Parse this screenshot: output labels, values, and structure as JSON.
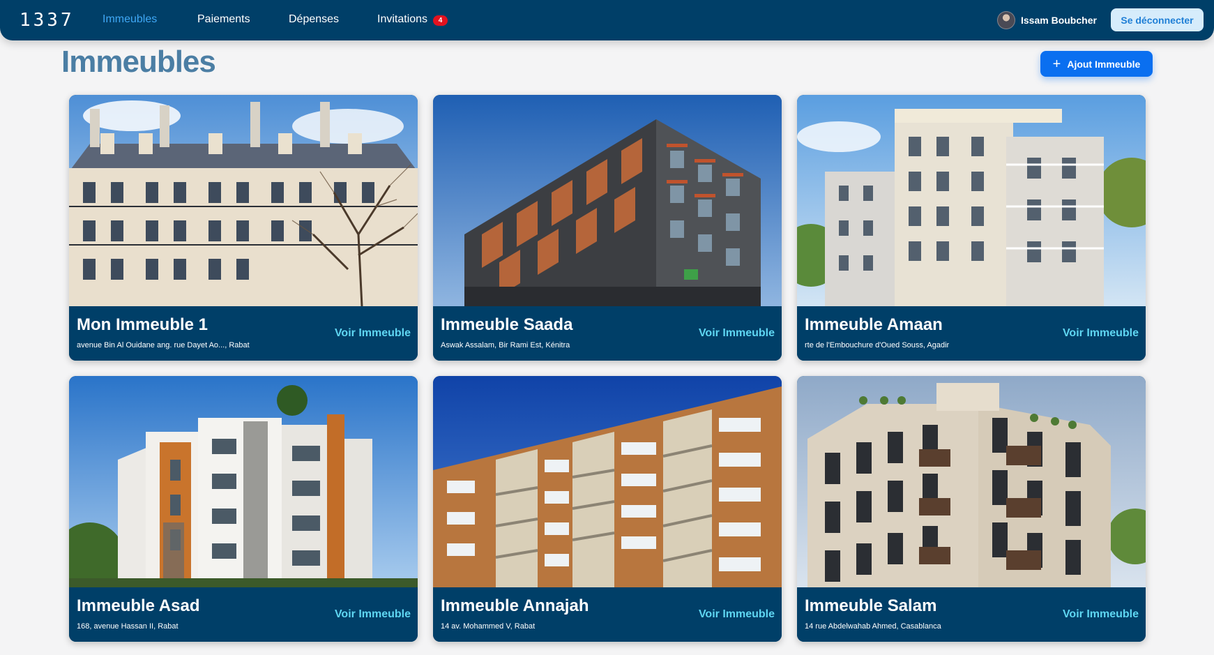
{
  "brand": {
    "logo_text": "1337"
  },
  "nav": {
    "items": [
      {
        "label": "Immeubles",
        "active": true
      },
      {
        "label": "Paiements",
        "active": false
      },
      {
        "label": "Dépenses",
        "active": false
      },
      {
        "label": "Invitations",
        "active": false
      }
    ],
    "invitations_badge": "4"
  },
  "user": {
    "name": "Issam Boubcher",
    "logout_label": "Se déconnecter"
  },
  "page": {
    "title": "Immeubles",
    "add_button_label": "Ajout Immeuble"
  },
  "buildings": [
    {
      "name": "Mon Immeuble 1",
      "address": "avenue Bin Al Ouidane ang. rue Dayet Ao..., Rabat",
      "link_label": "Voir Immeuble"
    },
    {
      "name": "Immeuble Saada",
      "address": "Aswak Assalam, Bir Rami Est, Kénitra",
      "link_label": "Voir Immeuble"
    },
    {
      "name": "Immeuble Amaan",
      "address": "rte de l'Embouchure d'Oued Souss, Agadir",
      "link_label": "Voir Immeuble"
    },
    {
      "name": "Immeuble Asad",
      "address": "168, avenue Hassan II, Rabat",
      "link_label": "Voir Immeuble"
    },
    {
      "name": "Immeuble Annajah",
      "address": "14 av. Mohammed V, Rabat",
      "link_label": "Voir Immeuble"
    },
    {
      "name": "Immeuble Salam",
      "address": "14 rue Abdelwahab Ahmed, Casablanca",
      "link_label": "Voir Immeuble"
    }
  ],
  "colors": {
    "navbar": "#003f68",
    "active_nav": "#3fa8f5",
    "accent_button": "#0a6ff0",
    "card_link": "#5fd6f2",
    "title": "#4b7ea4"
  }
}
